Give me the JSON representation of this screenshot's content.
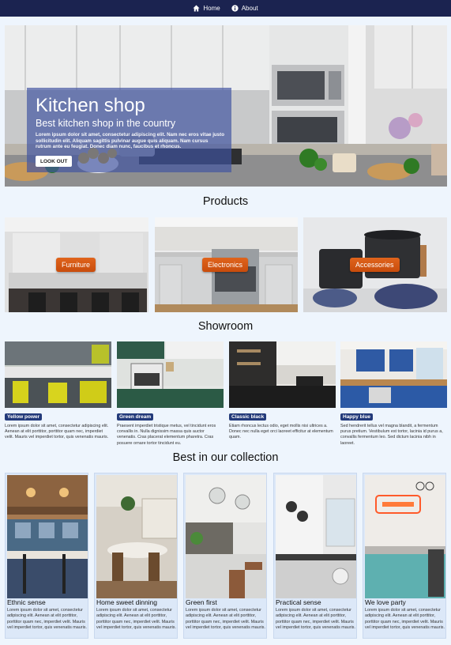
{
  "nav": {
    "items": [
      {
        "label": "Home",
        "icon": "home-icon"
      },
      {
        "label": "About",
        "icon": "info-icon"
      }
    ]
  },
  "hero": {
    "title": "Kitchen shop",
    "subtitle": "Best kitchen shop in the country",
    "text": "Lorem ipsum dolor sit amet, consectetur adipiscing elit. Nam nec eros vitae justo sollicitudin elit. Aliquam sagittis pulvinar augue quis aliquam. Nam cursus rutrum ante eu feugiat. Donec diam nunc, faucibus et rhoncus.",
    "button": "LOOK OUT"
  },
  "products": {
    "title": "Products",
    "items": [
      {
        "label": "Furniture"
      },
      {
        "label": "Electronics"
      },
      {
        "label": "Accessories"
      }
    ]
  },
  "showroom": {
    "title": "Showroom",
    "items": [
      {
        "badge": "Yellow power",
        "text": "Lorem ipsum dolor sit amet, consectetur adipiscing elit. Aenean at elit porttitor, porttitor quam nec, imperdiet velit. Mauris vel imperdiet tortor, quis venenatis mauris."
      },
      {
        "badge": "Green dream",
        "text": "Praesent imperdiet tristique metus, vel tincidunt eros convallis in. Nulla dignissim massa quis auctor venenatis. Cras placerat elementum pharetra. Cras posuere ornare tortor tincidunt eu."
      },
      {
        "badge": "Classic black",
        "text": "Etiam rhoncus lectus odio, eget mollis nisi ultrices a. Donec nec nulla eget orci laoreet efficitur at elementum quam."
      },
      {
        "badge": "Happy blue",
        "text": "Sed hendrerit tellus vel magna blandit, a fermentum purus pretium. Vestibulum est tortor, lacinia id purus a, convallis fermentum leo. Sed dictum lacinia nibh in laoreet."
      }
    ]
  },
  "collection": {
    "title": "Best in our collection",
    "items": [
      {
        "title": "Ethnic sense",
        "text": "Lorem ipsum dolor sit amet, consectetur adipiscing elit. Aenean at elit porttitor, porttitor quam nec, imperdiet velit. Mauris vel imperdiet tortor, quis venenatis mauris."
      },
      {
        "title": "Home sweet dinning",
        "text": "Lorem ipsum dolor sit amet, consectetur adipiscing elit. Aenean at elit porttitor, porttitor quam nec, imperdiet velit. Mauris vel imperdiet tortor, quis venenatis mauris."
      },
      {
        "title": "Green first",
        "text": "Lorem ipsum dolor sit amet, consectetur adipiscing elit. Aenean at elit porttitor, porttitor quam nec, imperdiet velit. Mauris vel imperdiet tortor, quis venenatis mauris."
      },
      {
        "title": "Practical sense",
        "text": "Lorem ipsum dolor sit amet, consectetur adipiscing elit. Aenean at elit porttitor, porttitor quam nec, imperdiet velit. Mauris vel imperdiet tortor, quis venenatis mauris."
      },
      {
        "title": "We love party",
        "text": "Lorem ipsum dolor sit amet, consectetur adipiscing elit. Aenean at elit porttitor, porttitor quam nec, imperdiet velit. Mauris vel imperdiet tortor, quis venenatis mauris."
      }
    ]
  },
  "colors": {
    "nav_bg": "#1b2350",
    "page_bg": "#eef5fd",
    "accent_orange": "#d9581a",
    "badge_blue": "#233a7a",
    "caption_panel": "#4052a0"
  }
}
